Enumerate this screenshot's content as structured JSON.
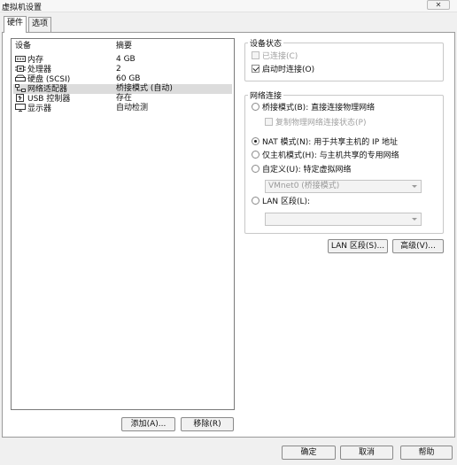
{
  "window": {
    "title": "虚拟机设置",
    "close_label": "✕"
  },
  "tabs": [
    {
      "label": "硬件",
      "active": true
    },
    {
      "label": "选项",
      "active": false
    }
  ],
  "device_table": {
    "headers": {
      "device": "设备",
      "summary": "摘要"
    },
    "rows": [
      {
        "icon": "memory-icon",
        "device": "内存",
        "summary": "4 GB"
      },
      {
        "icon": "processor-icon",
        "device": "处理器",
        "summary": "2"
      },
      {
        "icon": "hard-disk-icon",
        "device": "硬盘 (SCSI)",
        "summary": "60 GB"
      },
      {
        "icon": "network-adapter-icon",
        "device": "网络适配器",
        "summary": "桥接模式 (自动)",
        "selected": true
      },
      {
        "icon": "usb-controller-icon",
        "device": "USB 控制器",
        "summary": "存在"
      },
      {
        "icon": "display-icon",
        "device": "显示器",
        "summary": "自动检测"
      }
    ]
  },
  "list_buttons": {
    "add": "添加(A)...",
    "remove": "移除(R)"
  },
  "device_status": {
    "legend": "设备状态",
    "connected": {
      "label": "已连接(C)",
      "checked": false,
      "disabled": true
    },
    "connect_at_power_on": {
      "label": "启动时连接(O)",
      "checked": true,
      "disabled": false
    }
  },
  "network_connection": {
    "legend": "网络连接",
    "bridged": "桥接模式(B): 直接连接物理网络",
    "replicate": "复制物理网络连接状态(P)",
    "nat": "NAT 模式(N): 用于共享主机的 IP 地址",
    "host_only": "仅主机模式(H): 与主机共享的专用网络",
    "custom": "自定义(U): 特定虚拟网络",
    "custom_select": "VMnet0 (桥接模式)",
    "lan_segment": "LAN 区段(L):",
    "lan_select": "",
    "selected": "nat"
  },
  "network_buttons": {
    "lan_segments": "LAN 区段(S)...",
    "advanced": "高级(V)..."
  },
  "footer_buttons": {
    "ok": "确定",
    "cancel": "取消",
    "help": "帮助"
  }
}
